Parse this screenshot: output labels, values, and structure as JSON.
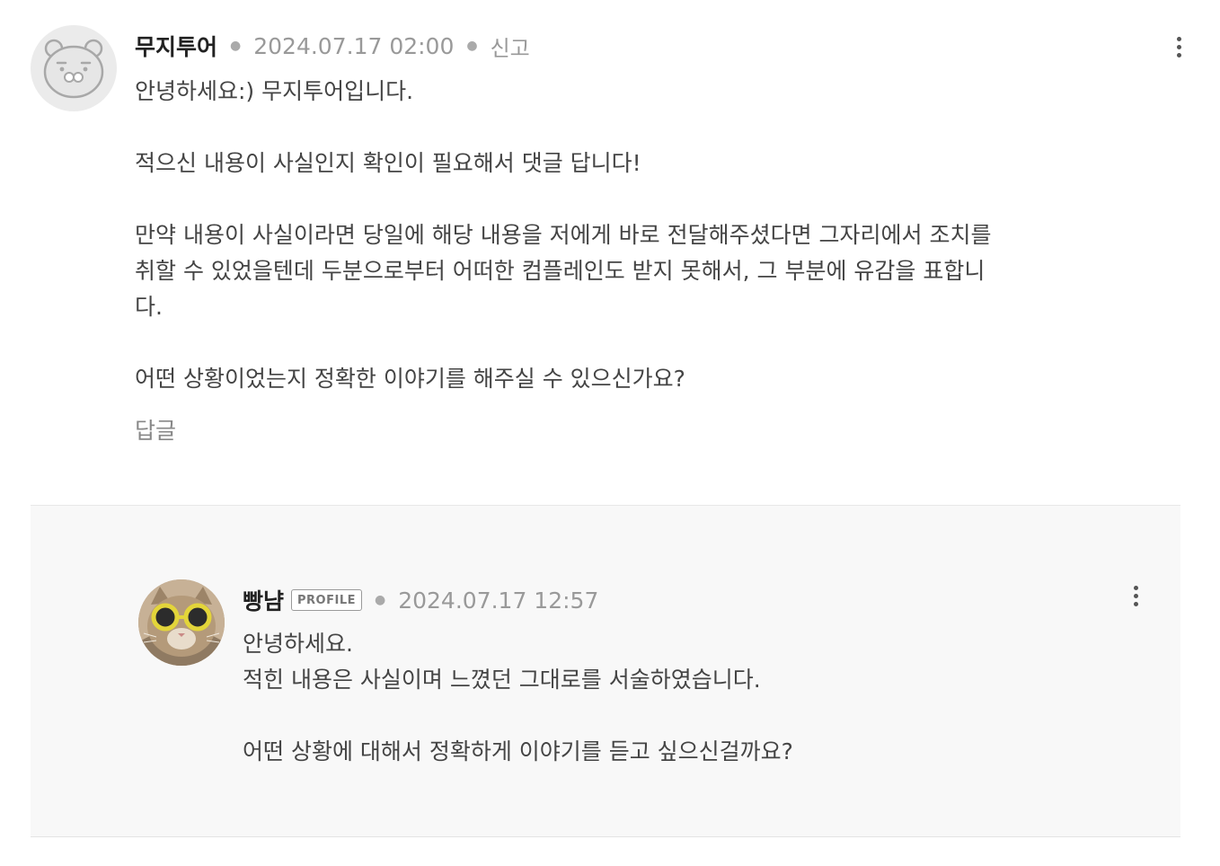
{
  "comment": {
    "author": "무지투어",
    "date": "2024.07.17 02:00",
    "report_label": "신고",
    "avatar_icon": "ryan-bear-avatar-icon",
    "more_icon": "more-vertical-icon",
    "paragraphs": [
      "안녕하세요:) 무지투어입니다.",
      "적으신 내용이 사실인지 확인이 필요해서 댓글 답니다!",
      "만약 내용이 사실이라면 당일에 해당 내용을 저에게 바로 전달해주셨다면 그자리에서 조치를 취할 수 있었을텐데 두분으로부터 어떠한 컴플레인도 받지 못해서, 그 부분에 유감을 표합니다.",
      "어떤 상황이었는지 정확한 이야기를 해주실 수 있으신가요?"
    ],
    "reply_label": "답글"
  },
  "reply": {
    "author": "빵냠",
    "badge": "PROFILE",
    "date": "2024.07.17 12:57",
    "avatar_icon": "cat-with-sunglasses-avatar",
    "more_icon": "more-vertical-icon",
    "lines": [
      "안녕하세요.",
      "적힌 내용은 사실이며 느꼈던 그대로를 서술하였습니다.",
      "어떤 상황에 대해서 정확하게 이야기를 듣고 싶으신걸까요?"
    ]
  },
  "colors": {
    "reply_background": "#f8f8f8",
    "meta_text": "#999999",
    "body_text": "#444444"
  }
}
